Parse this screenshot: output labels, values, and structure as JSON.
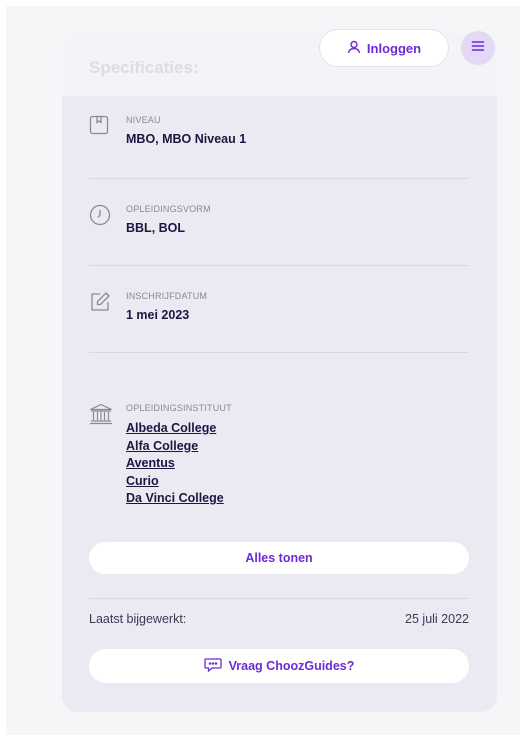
{
  "header": {
    "title": "Specificaties:",
    "login_label": "Inloggen",
    "login_icon": "user-icon",
    "menu_icon": "hamburger-icon"
  },
  "specs": {
    "niveau": {
      "label": "NIVEAU",
      "value": "MBO, MBO Niveau 1",
      "icon": "book-icon"
    },
    "opleidingsvorm": {
      "label": "OPLEIDINGSVORM",
      "value": "BBL, BOL",
      "icon": "clock-icon"
    },
    "inschrijfdatum": {
      "label": "INSCHRIJFDATUM",
      "value": "1 mei 2023",
      "icon": "edit-icon"
    },
    "instituut": {
      "label": "OPLEIDINGSINSTITUUT",
      "icon": "institution-icon",
      "items": [
        "Albeda College",
        "Alfa College",
        "Aventus",
        "Curio",
        "Da Vinci College"
      ]
    }
  },
  "show_all_label": "Alles tonen",
  "updated": {
    "label": "Laatst bijgewerkt:",
    "date": "25 juli 2022"
  },
  "ask_label": "Vraag ChoozGuides?",
  "ask_icon": "chat-icon",
  "colors": {
    "accent": "#6b2bd9",
    "card": "#ebeaf2",
    "text": "#1e1640"
  }
}
